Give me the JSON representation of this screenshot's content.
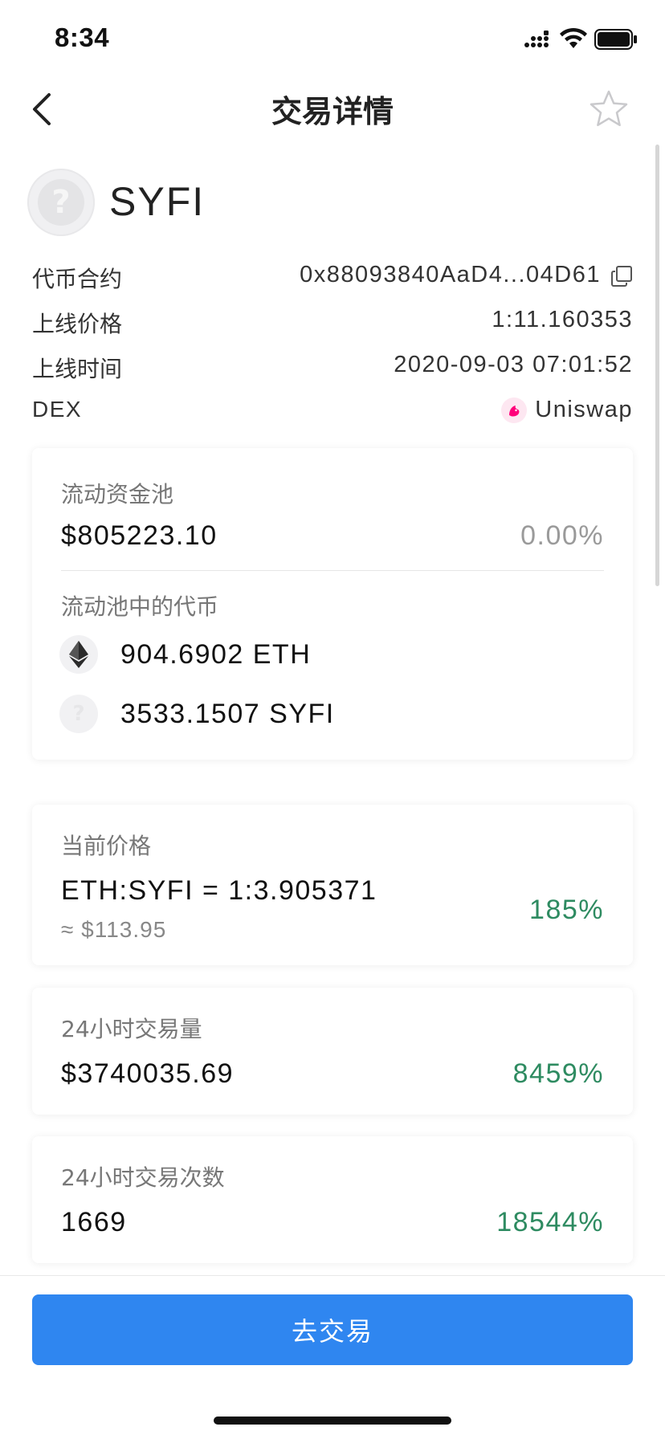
{
  "status_bar": {
    "time": "8:34"
  },
  "nav": {
    "title": "交易详情",
    "icons": {
      "back": "chevron-left-icon",
      "favorite": "star-outline-icon"
    }
  },
  "token": {
    "symbol": "SYFI",
    "logo_glyph": "?"
  },
  "info": {
    "contract": {
      "label": "代币合约",
      "value": "0x88093840AaD4...04D61"
    },
    "launch_price": {
      "label": "上线价格",
      "value": "1:11.160353"
    },
    "launch_time": {
      "label": "上线时间",
      "value": "2020-09-03 07:01:52"
    },
    "dex": {
      "label": "DEX",
      "value": "Uniswap"
    }
  },
  "liquidity_card": {
    "label": "流动资金池",
    "value": "$805223.10",
    "change": "0.00%",
    "pool_tokens_label": "流动池中的代币",
    "pool_tokens": [
      {
        "amount": "904.6902 ETH",
        "icon": "ethereum-icon"
      },
      {
        "amount": "3533.1507 SYFI",
        "icon": "unknown-token-icon"
      }
    ]
  },
  "price_card": {
    "label": "当前价格",
    "value": "ETH:SYFI = 1:3.905371",
    "approx_usd": "≈ $113.95",
    "change": "185%"
  },
  "volume_card": {
    "label": "24小时交易量",
    "value": "$3740035.69",
    "change": "8459%"
  },
  "trades_card": {
    "label": "24小时交易次数",
    "value": "1669",
    "change": "18544%"
  },
  "trade_button": {
    "label": "去交易"
  },
  "colors": {
    "accent_blue": "#2f86f0",
    "positive_green": "#2e8b61",
    "neutral_gray": "#9a9a9a"
  }
}
